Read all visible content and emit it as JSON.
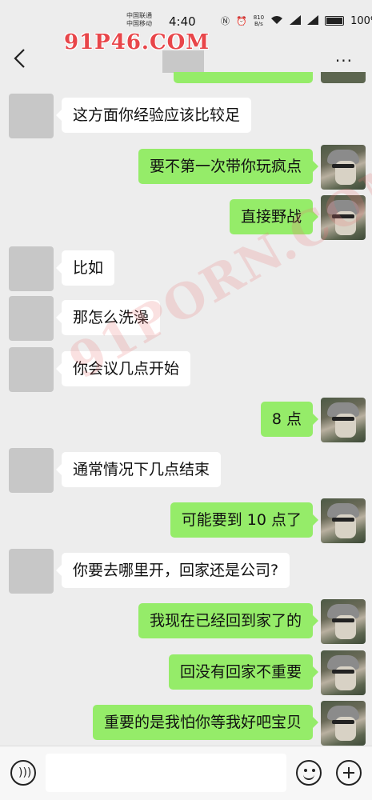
{
  "status_bar": {
    "carrier_1": "中国联通",
    "carrier_2": "中国移动",
    "time": "4:40",
    "net_speed_value": "810",
    "net_speed_unit": "B/s",
    "battery": "100%"
  },
  "watermarks": {
    "top": "91P46.COM",
    "diagonal": "91PORN.COM"
  },
  "messages": [
    {
      "side": "left",
      "text": "这方面你经验应该比较足"
    },
    {
      "side": "right",
      "text": "要不第一次带你玩疯点"
    },
    {
      "side": "right",
      "text": "直接野战"
    },
    {
      "side": "left",
      "text": "比如"
    },
    {
      "side": "left",
      "text": "那怎么洗澡"
    },
    {
      "side": "left",
      "text": "你会议几点开始"
    },
    {
      "side": "right",
      "text": "8 点"
    },
    {
      "side": "left",
      "text": "通常情况下几点结束"
    },
    {
      "side": "right",
      "text": "可能要到 10 点了"
    },
    {
      "side": "left",
      "text": "你要去哪里开，回家还是公司?"
    },
    {
      "side": "right",
      "text": "我现在已经回到家了的"
    },
    {
      "side": "right",
      "text": "回没有回家不重要"
    },
    {
      "side": "right",
      "text": "重要的是我怕你等我好吧宝贝"
    }
  ],
  "icons": {
    "back": "chevron-left-icon",
    "more": "more-dots-icon",
    "voice": "voice-icon",
    "emoji": "emoji-icon",
    "plus": "plus-icon"
  },
  "colors": {
    "sent_bubble": "#95ec69",
    "received_bubble": "#ffffff",
    "background": "#ededed"
  }
}
